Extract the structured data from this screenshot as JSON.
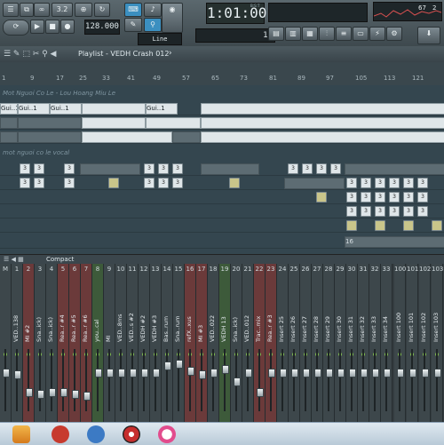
{
  "toolbar": {
    "time": "1:01:00",
    "time_suffix": "B:S:T",
    "tempo": "128.000",
    "pattern": "15",
    "pattern_mode": "Line",
    "song_pos": "3.2",
    "cpu": "67",
    "mem": "2"
  },
  "playlist": {
    "title": "Playlist - VEDH Crash 012",
    "ruler_ticks": [
      "1",
      "9",
      "17",
      "25",
      "33",
      "41",
      "49",
      "57",
      "65",
      "73",
      "81",
      "89",
      "97",
      "105",
      "113",
      "121"
    ],
    "track_names": [
      "Mot Nguoi Co Le - Lou Hoang Miu Le",
      "mot nguoi co le vocal"
    ],
    "clip_label": "Gui..1",
    "pattern_num": "3",
    "pattern_num_end": "16"
  },
  "mixer": {
    "label": "Compact",
    "channels": [
      {
        "num": "M",
        "name": "",
        "color": "#3d474b"
      },
      {
        "num": "1",
        "name": "VED..138",
        "color": "#3d474b"
      },
      {
        "num": "2",
        "name": "MI #2",
        "color": "#6b3a3a"
      },
      {
        "num": "3",
        "name": "Sna..ick)",
        "color": "#3d474b"
      },
      {
        "num": "4",
        "name": "Sna..ick)",
        "color": "#3d474b"
      },
      {
        "num": "5",
        "name": "Rea..r #4",
        "color": "#6b3a3a"
      },
      {
        "num": "6",
        "name": "Rea..r #5",
        "color": "#6b3a3a"
      },
      {
        "num": "7",
        "name": "Rea..r #6",
        "color": "#6b3a3a"
      },
      {
        "num": "8",
        "name": "you..cal",
        "color": "#3d5a3a"
      },
      {
        "num": "9",
        "name": "MI",
        "color": "#3d474b"
      },
      {
        "num": "10",
        "name": "VED..8ms",
        "color": "#3d474b"
      },
      {
        "num": "11",
        "name": "VED..s #2",
        "color": "#3d474b"
      },
      {
        "num": "12",
        "name": "VEDH #2",
        "color": "#3d474b"
      },
      {
        "num": "13",
        "name": "VEDH #3",
        "color": "#3d474b"
      },
      {
        "num": "14",
        "name": "Bas..rum",
        "color": "#3d474b"
      },
      {
        "num": "15",
        "name": "Sna..rum",
        "color": "#3d474b"
      },
      {
        "num": "16",
        "name": "refX..xus",
        "color": "#6b3a3a"
      },
      {
        "num": "17",
        "name": "MI #3",
        "color": "#6b3a3a"
      },
      {
        "num": "18",
        "name": "VED..022",
        "color": "#3d474b"
      },
      {
        "num": "19",
        "name": "VEDH 13",
        "color": "#3d5a3a"
      },
      {
        "num": "20",
        "name": "Sna..ick)",
        "color": "#3d474b"
      },
      {
        "num": "21",
        "name": "VED..012",
        "color": "#3d474b"
      },
      {
        "num": "22",
        "name": "Trac..mix",
        "color": "#6b3a3a"
      },
      {
        "num": "23",
        "name": "Rea..r #3",
        "color": "#6b3a3a"
      },
      {
        "num": "24",
        "name": "Insert 25",
        "color": "#3d474b"
      },
      {
        "num": "25",
        "name": "Insert 26",
        "color": "#3d474b"
      },
      {
        "num": "26",
        "name": "Insert 27",
        "color": "#3d474b"
      },
      {
        "num": "27",
        "name": "Insert 28",
        "color": "#3d474b"
      },
      {
        "num": "28",
        "name": "Insert 29",
        "color": "#3d474b"
      },
      {
        "num": "29",
        "name": "Insert 30",
        "color": "#3d474b"
      },
      {
        "num": "30",
        "name": "Insert 31",
        "color": "#3d474b"
      },
      {
        "num": "31",
        "name": "Insert 32",
        "color": "#3d474b"
      },
      {
        "num": "32",
        "name": "Insert 33",
        "color": "#3d474b"
      },
      {
        "num": "33",
        "name": "Insert 34",
        "color": "#3d474b"
      },
      {
        "num": "100",
        "name": "Insert 100",
        "color": "#3d474b"
      },
      {
        "num": "101",
        "name": "Insert 101",
        "color": "#3d474b"
      },
      {
        "num": "102",
        "name": "Insert 102",
        "color": "#3d474b"
      },
      {
        "num": "103",
        "name": "Insert 103",
        "color": "#3d474b"
      }
    ]
  },
  "taskbar": {
    "icons": [
      "fl-studio-icon",
      "fl-studio-red-icon",
      "messenger-icon",
      "chrome-icon",
      "itunes-icon"
    ]
  }
}
